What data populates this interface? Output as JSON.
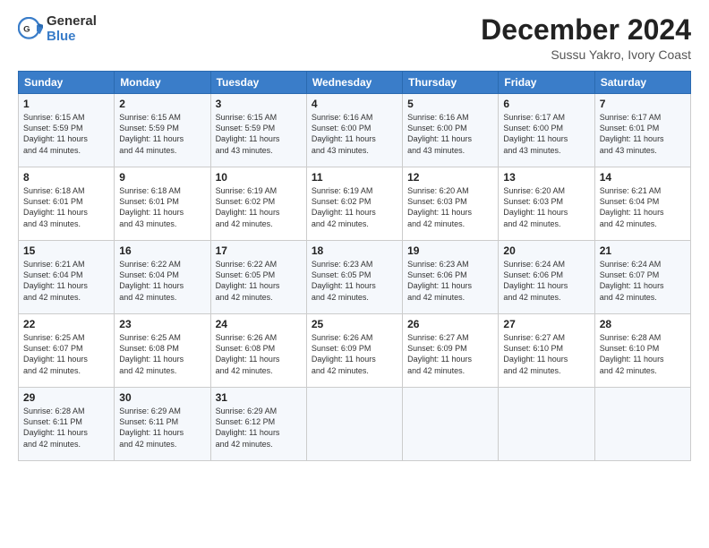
{
  "header": {
    "logo_general": "General",
    "logo_blue": "Blue",
    "month_title": "December 2024",
    "location": "Sussu Yakro, Ivory Coast"
  },
  "calendar": {
    "days_of_week": [
      "Sunday",
      "Monday",
      "Tuesday",
      "Wednesday",
      "Thursday",
      "Friday",
      "Saturday"
    ],
    "weeks": [
      [
        {
          "day": 1,
          "info": "Sunrise: 6:15 AM\nSunset: 5:59 PM\nDaylight: 11 hours\nand 44 minutes."
        },
        {
          "day": 2,
          "info": "Sunrise: 6:15 AM\nSunset: 5:59 PM\nDaylight: 11 hours\nand 44 minutes."
        },
        {
          "day": 3,
          "info": "Sunrise: 6:15 AM\nSunset: 5:59 PM\nDaylight: 11 hours\nand 43 minutes."
        },
        {
          "day": 4,
          "info": "Sunrise: 6:16 AM\nSunset: 6:00 PM\nDaylight: 11 hours\nand 43 minutes."
        },
        {
          "day": 5,
          "info": "Sunrise: 6:16 AM\nSunset: 6:00 PM\nDaylight: 11 hours\nand 43 minutes."
        },
        {
          "day": 6,
          "info": "Sunrise: 6:17 AM\nSunset: 6:00 PM\nDaylight: 11 hours\nand 43 minutes."
        },
        {
          "day": 7,
          "info": "Sunrise: 6:17 AM\nSunset: 6:01 PM\nDaylight: 11 hours\nand 43 minutes."
        }
      ],
      [
        {
          "day": 8,
          "info": "Sunrise: 6:18 AM\nSunset: 6:01 PM\nDaylight: 11 hours\nand 43 minutes."
        },
        {
          "day": 9,
          "info": "Sunrise: 6:18 AM\nSunset: 6:01 PM\nDaylight: 11 hours\nand 43 minutes."
        },
        {
          "day": 10,
          "info": "Sunrise: 6:19 AM\nSunset: 6:02 PM\nDaylight: 11 hours\nand 42 minutes."
        },
        {
          "day": 11,
          "info": "Sunrise: 6:19 AM\nSunset: 6:02 PM\nDaylight: 11 hours\nand 42 minutes."
        },
        {
          "day": 12,
          "info": "Sunrise: 6:20 AM\nSunset: 6:03 PM\nDaylight: 11 hours\nand 42 minutes."
        },
        {
          "day": 13,
          "info": "Sunrise: 6:20 AM\nSunset: 6:03 PM\nDaylight: 11 hours\nand 42 minutes."
        },
        {
          "day": 14,
          "info": "Sunrise: 6:21 AM\nSunset: 6:04 PM\nDaylight: 11 hours\nand 42 minutes."
        }
      ],
      [
        {
          "day": 15,
          "info": "Sunrise: 6:21 AM\nSunset: 6:04 PM\nDaylight: 11 hours\nand 42 minutes."
        },
        {
          "day": 16,
          "info": "Sunrise: 6:22 AM\nSunset: 6:04 PM\nDaylight: 11 hours\nand 42 minutes."
        },
        {
          "day": 17,
          "info": "Sunrise: 6:22 AM\nSunset: 6:05 PM\nDaylight: 11 hours\nand 42 minutes."
        },
        {
          "day": 18,
          "info": "Sunrise: 6:23 AM\nSunset: 6:05 PM\nDaylight: 11 hours\nand 42 minutes."
        },
        {
          "day": 19,
          "info": "Sunrise: 6:23 AM\nSunset: 6:06 PM\nDaylight: 11 hours\nand 42 minutes."
        },
        {
          "day": 20,
          "info": "Sunrise: 6:24 AM\nSunset: 6:06 PM\nDaylight: 11 hours\nand 42 minutes."
        },
        {
          "day": 21,
          "info": "Sunrise: 6:24 AM\nSunset: 6:07 PM\nDaylight: 11 hours\nand 42 minutes."
        }
      ],
      [
        {
          "day": 22,
          "info": "Sunrise: 6:25 AM\nSunset: 6:07 PM\nDaylight: 11 hours\nand 42 minutes."
        },
        {
          "day": 23,
          "info": "Sunrise: 6:25 AM\nSunset: 6:08 PM\nDaylight: 11 hours\nand 42 minutes."
        },
        {
          "day": 24,
          "info": "Sunrise: 6:26 AM\nSunset: 6:08 PM\nDaylight: 11 hours\nand 42 minutes."
        },
        {
          "day": 25,
          "info": "Sunrise: 6:26 AM\nSunset: 6:09 PM\nDaylight: 11 hours\nand 42 minutes."
        },
        {
          "day": 26,
          "info": "Sunrise: 6:27 AM\nSunset: 6:09 PM\nDaylight: 11 hours\nand 42 minutes."
        },
        {
          "day": 27,
          "info": "Sunrise: 6:27 AM\nSunset: 6:10 PM\nDaylight: 11 hours\nand 42 minutes."
        },
        {
          "day": 28,
          "info": "Sunrise: 6:28 AM\nSunset: 6:10 PM\nDaylight: 11 hours\nand 42 minutes."
        }
      ],
      [
        {
          "day": 29,
          "info": "Sunrise: 6:28 AM\nSunset: 6:11 PM\nDaylight: 11 hours\nand 42 minutes."
        },
        {
          "day": 30,
          "info": "Sunrise: 6:29 AM\nSunset: 6:11 PM\nDaylight: 11 hours\nand 42 minutes."
        },
        {
          "day": 31,
          "info": "Sunrise: 6:29 AM\nSunset: 6:12 PM\nDaylight: 11 hours\nand 42 minutes."
        },
        null,
        null,
        null,
        null
      ]
    ]
  }
}
